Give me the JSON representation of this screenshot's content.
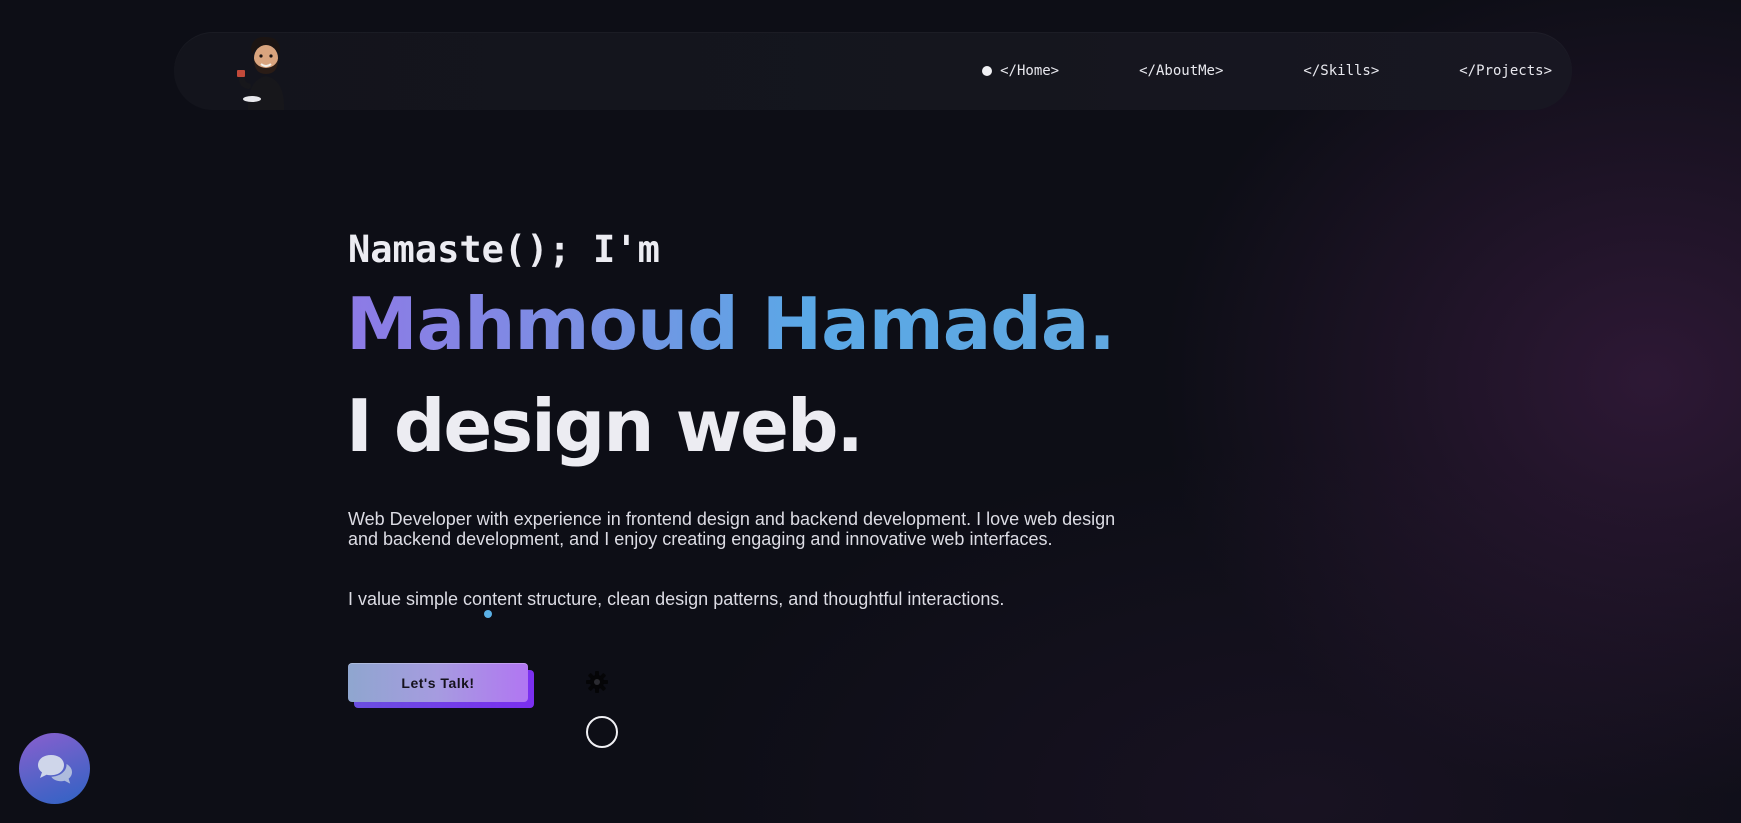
{
  "navbar": {
    "avatar_icon": "bitmoji-avatar-icon",
    "items": [
      {
        "label": "</Home>",
        "active": true
      },
      {
        "label": "</AboutMe>",
        "active": false
      },
      {
        "label": "</Skills>",
        "active": false
      },
      {
        "label": "</Projects>",
        "active": false
      }
    ]
  },
  "hero": {
    "greeting": "Namaste(); I'm",
    "name": "Mahmoud Hamada.",
    "tagline": "I design web.",
    "description": "Web Developer with experience in frontend design and backend development. I love web design and backend development, and I enjoy creating engaging and innovative web interfaces.",
    "description2": "I value simple content structure, clean design patterns, and thoughtful interactions.",
    "cta_label": "Let's Talk!"
  },
  "icons": {
    "settings": "gear-icon",
    "ring": "circle-outline-icon",
    "chat": "chat-bubbles-icon"
  },
  "colors": {
    "background": "#0d0e16",
    "name_gradient_start": "#8d7ae6",
    "name_gradient_end": "#60a8e0",
    "cta_gradient_start": "#8fa6cf",
    "cta_gradient_end": "#b176f2",
    "chat_fab_start": "#8a5fcf",
    "chat_fab_end": "#2f63c4"
  }
}
